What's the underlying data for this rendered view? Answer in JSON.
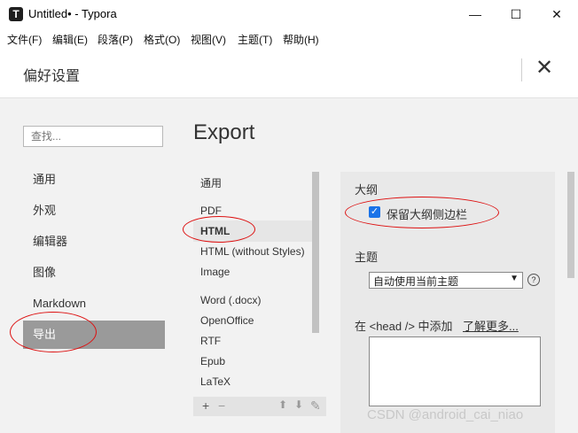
{
  "window": {
    "title": "Untitled• - Typora",
    "app_icon": "T",
    "controls": [
      "—",
      "☐",
      "✕"
    ]
  },
  "menu": [
    "文件(F)",
    "编辑(E)",
    "段落(P)",
    "格式(O)",
    "视图(V)",
    "主题(T)",
    "帮助(H)"
  ],
  "dialog": {
    "title": "偏好设置",
    "close": "✕"
  },
  "sidebar": {
    "search_placeholder": "查找...",
    "items": [
      "通用",
      "外观",
      "编辑器",
      "图像",
      "Markdown",
      "导出"
    ],
    "active": "导出"
  },
  "export": {
    "title": "Export",
    "formats": [
      "通用",
      "PDF",
      "HTML",
      "HTML (without Styles)",
      "Image",
      "Word (.docx)",
      "OpenOffice",
      "RTF",
      "Epub",
      "LaTeX"
    ],
    "selected": "HTML"
  },
  "toolbar": {
    "add": "+",
    "remove": "−",
    "up": "⬆",
    "down": "⬇",
    "edit": "✎"
  },
  "panel": {
    "outline_label": "大纲",
    "keep_outline_label": "保留大纲侧边栏",
    "keep_outline_checked": true,
    "theme_label": "主题",
    "theme_value": "自动使用当前主题",
    "head_label": "在 <head /> 中添加",
    "learn_more": "了解更多..."
  },
  "watermark": "CSDN @android_cai_niao"
}
